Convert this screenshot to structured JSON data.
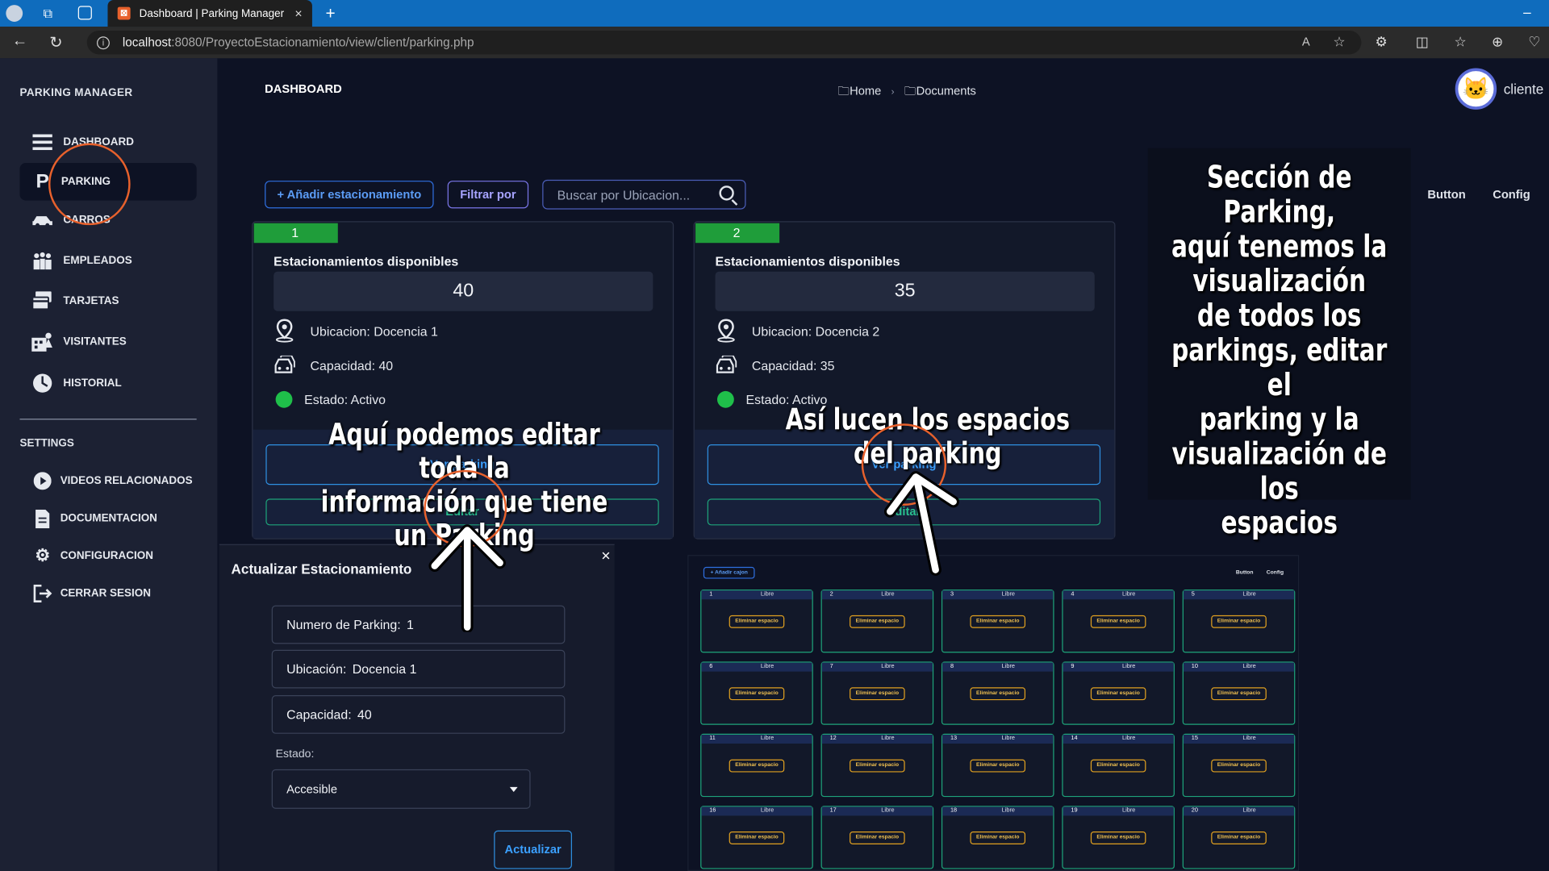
{
  "browser": {
    "tab_title": "Dashboard | Parking Manager",
    "tab_close": "×",
    "new_tab": "+",
    "url_host": "localhost",
    "url_rest": ":8080/ProyectoEstacionamiento/view/client/parking.php"
  },
  "sidebar": {
    "brand": "PARKING MANAGER",
    "items": [
      {
        "label": "DASHBOARD",
        "icon": "menu-icon"
      },
      {
        "label": "PARKING",
        "icon": "parking-icon"
      },
      {
        "label": "CARROS",
        "icon": "car-icon"
      },
      {
        "label": "EMPLEADOS",
        "icon": "employees-icon"
      },
      {
        "label": "TARJETAS",
        "icon": "cards-icon"
      },
      {
        "label": "VISITANTES",
        "icon": "visitors-icon"
      },
      {
        "label": "HISTORIAL",
        "icon": "history-icon"
      }
    ],
    "settings_heading": "SETTINGS",
    "settings_items": [
      {
        "label": "VIDEOS RELACIONADOS",
        "icon": "play-icon"
      },
      {
        "label": "DOCUMENTACION",
        "icon": "document-icon"
      },
      {
        "label": "CONFIGURACION",
        "icon": "gears-icon"
      },
      {
        "label": "CERRAR SESION",
        "icon": "logout-icon"
      }
    ]
  },
  "header": {
    "title": "DASHBOARD",
    "breadcrumb": [
      "Home",
      "Documents"
    ],
    "user_name": "cliente"
  },
  "toolbar": {
    "add_label": "+ Añadir estacionamiento",
    "filter_label": "Filtrar por",
    "search_placeholder": "Buscar por Ubicacion...",
    "button_link": "Button",
    "config_link": "Config"
  },
  "cards": [
    {
      "number": "1",
      "title": "Estacionamientos disponibles",
      "available": "40",
      "location": "Ubicacion: Docencia 1",
      "capacity": "Capacidad: 40",
      "status": "Estado: Activo",
      "view_label": "Ver parking",
      "edit_label": "Editar"
    },
    {
      "number": "2",
      "title": "Estacionamientos disponibles",
      "available": "35",
      "location": "Ubicacion: Docencia 2",
      "capacity": "Capacidad: 35",
      "status": "Estado: Activo",
      "view_label": "Ver parking",
      "edit_label": "Editar"
    }
  ],
  "annotations": {
    "right_box": [
      "Sección de Parking,",
      "aquí tenemos la",
      "visualización",
      "de todos los",
      "parkings, editar el",
      "parking y la",
      "visualización de los",
      "espacios"
    ],
    "edit_note": [
      "Aquí podemos editar toda la",
      "información que tiene un Parking"
    ],
    "spaces_note": "Así lucen los espacios del parking"
  },
  "modal": {
    "title": "Actualizar Estacionamiento",
    "close": "×",
    "fields": [
      {
        "label": "Numero de Parking:",
        "value": "1"
      },
      {
        "label": "Ubicación:",
        "value": "Docencia 1"
      },
      {
        "label": "Capacidad:",
        "value": "40"
      }
    ],
    "status_label": "Estado:",
    "status_value": "Accesible",
    "submit_label": "Actualizar"
  },
  "spaces_preview": {
    "add_label": "+ Añadir cajon",
    "button_link": "Button",
    "config_link": "Config",
    "status_text": "Libre",
    "delete_label": "Eliminar espacio",
    "slots": [
      "1",
      "2",
      "3",
      "4",
      "5",
      "6",
      "7",
      "8",
      "9",
      "10",
      "11",
      "12",
      "13",
      "14",
      "15",
      "16",
      "17",
      "18",
      "19",
      "20"
    ]
  },
  "colors": {
    "accent_orange": "#e8612c",
    "status_green": "#1fbf4a",
    "header_green": "#1f9d3a",
    "primary_blue": "#2f8fe0"
  }
}
